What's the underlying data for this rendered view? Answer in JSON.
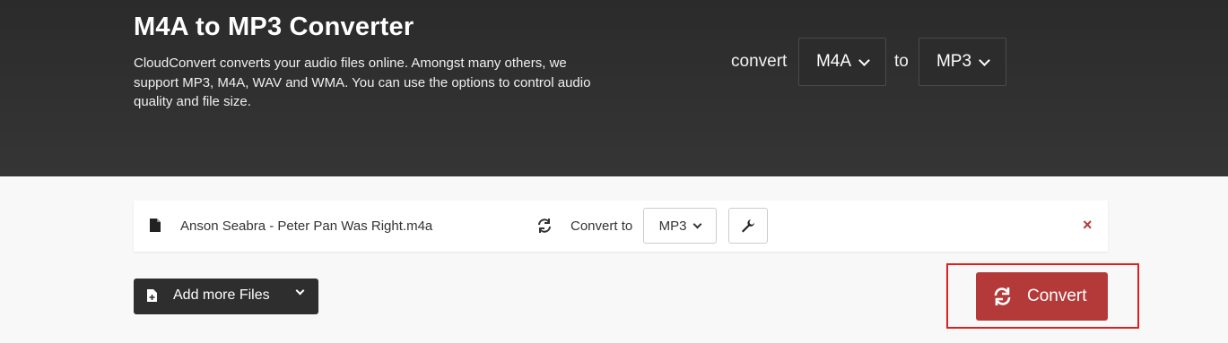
{
  "header": {
    "title": "M4A to MP3 Converter",
    "description": "CloudConvert converts your audio files online. Amongst many others, we support MP3, M4A, WAV and WMA. You can use the options to control audio quality and file size.",
    "convert_label": "convert",
    "from_format": "M4A",
    "to_label": "to",
    "to_format": "MP3"
  },
  "file": {
    "name": "Anson Seabra - Peter Pan Was Right.m4a",
    "convert_to_label": "Convert to",
    "target_format": "MP3",
    "remove_symbol": "×"
  },
  "actions": {
    "add_more_label": "Add more Files",
    "convert_label": "Convert"
  },
  "colors": {
    "hero_bg": "#2e2e2e",
    "accent_red": "#b43a3a",
    "highlight": "#e02020"
  },
  "icons": [
    "file-icon",
    "refresh-icon",
    "wrench-icon",
    "close-icon",
    "add-file-icon",
    "chevron-down-icon",
    "sync-icon"
  ]
}
